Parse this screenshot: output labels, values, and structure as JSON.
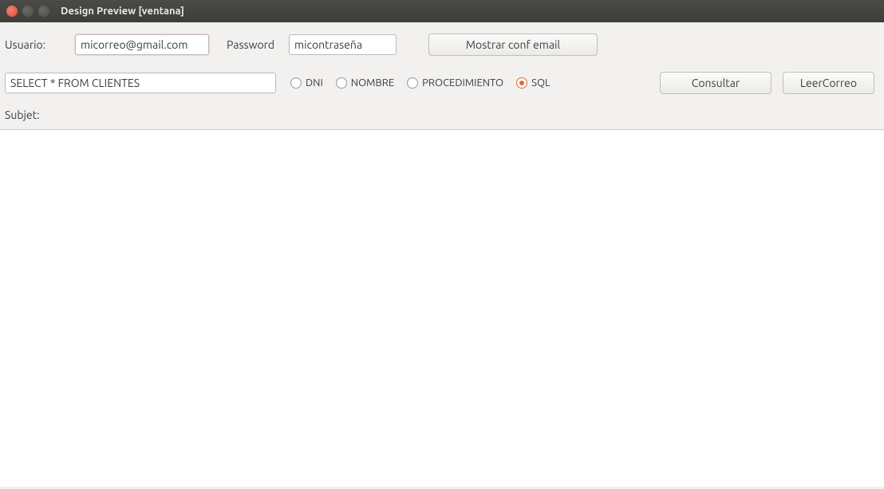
{
  "window": {
    "title": "Design Preview [ventana]"
  },
  "form": {
    "usuario_label": "Usuario:",
    "usuario_value": "micorreo@gmail.com",
    "password_label": "Password",
    "password_value": "micontraseña",
    "mostrar_button": "Mostrar conf email",
    "query_value": "SELECT * FROM CLIENTES",
    "radios": {
      "dni": "DNI",
      "nombre": "NOMBRE",
      "procedimiento": "PROCEDIMIENTO",
      "sql": "SQL",
      "selected": "sql"
    },
    "consultar_button": "Consultar",
    "leercorreo_button": "LeerCorreo",
    "subject_label": "Subjet:"
  }
}
